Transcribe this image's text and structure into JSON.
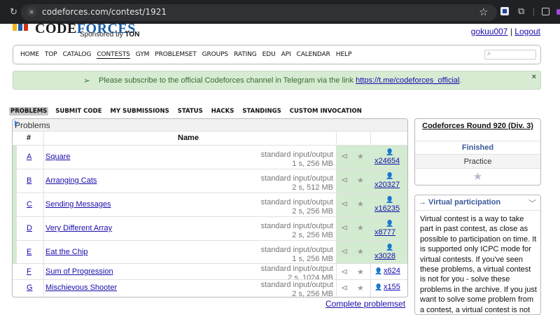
{
  "browser": {
    "url": "codeforces.com/contest/1921",
    "reload_icon": "reload-icon",
    "site_info_icon": "tune-icon",
    "bookmark_icon": "star-icon"
  },
  "header": {
    "logo_part1": "CODE",
    "logo_part2": "FORCES",
    "sponsor_prefix": "Sponsored by",
    "sponsor_name": "TON",
    "user": "gokuu007",
    "separator": "|",
    "logout": "Logout"
  },
  "menu": {
    "items": [
      "HOME",
      "TOP",
      "CATALOG",
      "CONTESTS",
      "GYM",
      "PROBLEMSET",
      "GROUPS",
      "RATING",
      "EDU",
      "API",
      "CALENDAR",
      "HELP"
    ],
    "active": "CONTESTS",
    "search_placeholder": ""
  },
  "notice": {
    "text": "Please subscribe to the official Codeforces channel in Telegram via the link",
    "link": "https://t.me/codeforces_official",
    "tail": ".",
    "close": "×"
  },
  "submenu": {
    "items": [
      "PROBLEMS",
      "SUBMIT CODE",
      "MY SUBMISSIONS",
      "STATUS",
      "HACKS",
      "STANDINGS",
      "CUSTOM INVOCATION"
    ],
    "active": "PROBLEMS"
  },
  "problems": {
    "caption": "Problems",
    "col_num": "#",
    "col_name": "Name",
    "rows": [
      {
        "idx": "A",
        "name": "Square",
        "io": "standard input/output",
        "limits": "1 s, 256 MB",
        "solved": "x24654",
        "accepted": true
      },
      {
        "idx": "B",
        "name": "Arranging Cats",
        "io": "standard input/output",
        "limits": "2 s, 512 MB",
        "solved": "x20327",
        "accepted": true
      },
      {
        "idx": "C",
        "name": "Sending Messages",
        "io": "standard input/output",
        "limits": "2 s, 256 MB",
        "solved": "x16235",
        "accepted": true
      },
      {
        "idx": "D",
        "name": "Very Different Array",
        "io": "standard input/output",
        "limits": "2 s, 256 MB",
        "solved": "x8777",
        "accepted": true
      },
      {
        "idx": "E",
        "name": "Eat the Chip",
        "io": "standard input/output",
        "limits": "1 s, 256 MB",
        "solved": "x3028",
        "accepted": true
      },
      {
        "idx": "F",
        "name": "Sum of Progression",
        "io": "standard input/output",
        "limits": "2 s, 1024 MB",
        "solved": "x624",
        "accepted": false
      },
      {
        "idx": "G",
        "name": "Mischievous Shooter",
        "io": "standard input/output",
        "limits": "2 s, 256 MB",
        "solved": "x155",
        "accepted": false
      }
    ],
    "complete_link": "Complete problemset"
  },
  "round": {
    "title": "Codeforces Round 920 (Div. 3)",
    "status": "Finished",
    "practice": "Practice"
  },
  "virtual": {
    "title": "→ Virtual participation",
    "text": "Virtual contest is a way to take part in past contest, as close as possible to participation on time. It is supported only ICPC mode for virtual contests. If you've seen these problems, a virtual contest is not for you - solve these problems in the archive. If you just want to solve some problem from a contest, a virtual contest is not for you."
  }
}
